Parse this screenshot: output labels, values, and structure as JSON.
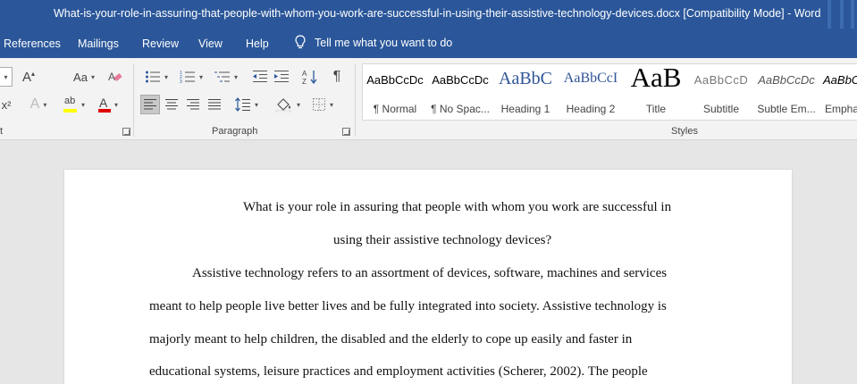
{
  "window": {
    "title": "What-is-your-role-in-assuring-that-people-with-whom-you-work-are-successful-in-using-their-assistive-technology-devices.docx [Compatibility Mode]  -  Word"
  },
  "menu": {
    "tabs": [
      "References",
      "Mailings",
      "Review",
      "View",
      "Help"
    ],
    "tell_me": "Tell me what you want to do"
  },
  "ribbon": {
    "font_group": {
      "label": "t",
      "grow_label": "A",
      "change_case_label": "Aa",
      "superscript_label": "x²",
      "text_effects_label": "A",
      "highlight_label": "ab",
      "font_color_label": "A",
      "highlight_color": "#ffff00",
      "font_color": "#e00000"
    },
    "paragraph_group": {
      "label": "Paragraph",
      "pilcrow": "¶"
    },
    "styles_group": {
      "label": "Styles",
      "items": [
        {
          "preview": "AaBbCcDc",
          "name": "¶ Normal"
        },
        {
          "preview": "AaBbCcDc",
          "name": "¶ No Spac..."
        },
        {
          "preview": "AaBbC",
          "name": "Heading 1"
        },
        {
          "preview": "AaBbCcI",
          "name": "Heading 2"
        },
        {
          "preview": "AaB",
          "name": "Title"
        },
        {
          "preview": "AaBbCcD",
          "name": "Subtitle"
        },
        {
          "preview": "AaBbCcDc",
          "name": "Subtle Em..."
        },
        {
          "preview": "AaBbCc",
          "name": "Empha"
        }
      ],
      "heading_color": "#2f5496"
    }
  },
  "document": {
    "title_line1": "What is your role in assuring that people with whom you work are successful in",
    "title_line2": "using their assistive technology devices?",
    "lines": [
      "Assistive technology refers to an assortment of devices, software, machines and services",
      "meant to help people live better lives and be fully integrated into society. Assistive technology is",
      "majorly meant to help children, the disabled and the elderly to cope up easily and faster in",
      "educational systems, leisure practices and employment activities (Scherer, 2002). The people"
    ]
  }
}
